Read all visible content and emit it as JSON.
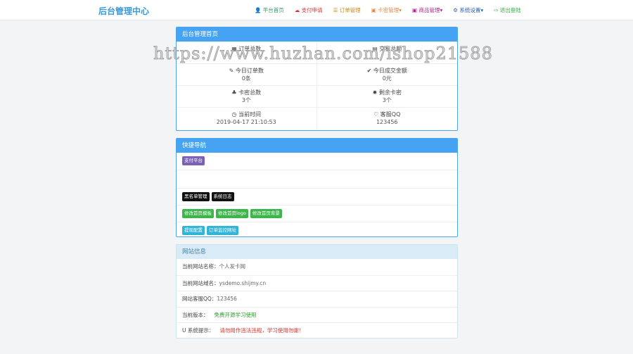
{
  "header": {
    "brand": "后台管理中心",
    "nav": [
      {
        "label": "平台首页",
        "icon": "user-icon",
        "color": "#3a9a6a"
      },
      {
        "label": "支付申请",
        "icon": "cloud-icon",
        "color": "#d9302c"
      },
      {
        "label": "订单管理",
        "icon": "list-icon",
        "color": "#c98a1f"
      },
      {
        "label": "卡密管理▾",
        "icon": "card-icon",
        "color": "#e08a4a"
      },
      {
        "label": "商品管理▾",
        "icon": "goods-icon",
        "color": "#b0268a"
      },
      {
        "label": "系统设置▾",
        "icon": "gear-icon",
        "color": "#2a5fb0"
      },
      {
        "label": "退出登陆",
        "icon": "logout-icon",
        "color": "#3aab4a"
      }
    ]
  },
  "home": {
    "title": "后台管理首页",
    "stats": [
      {
        "icon": "▦",
        "label": "订单总数",
        "value": ""
      },
      {
        "icon": "▤",
        "label": "交易总额",
        "value": ""
      },
      {
        "icon": "✎",
        "label": "今日订单数",
        "value": "0条"
      },
      {
        "icon": "✔",
        "label": "今日成交金额",
        "value": "0元"
      },
      {
        "icon": "♣",
        "label": "卡密总数",
        "value": "3个"
      },
      {
        "icon": "✹",
        "label": "剩余卡密",
        "value": "3个"
      },
      {
        "icon": "◷",
        "label": "当前时间",
        "value": "2019-04-17 21:10:53"
      },
      {
        "icon": "♡",
        "label": "客服QQ",
        "value": "123456"
      }
    ]
  },
  "quick": {
    "title": "快捷导航",
    "rows": [
      [
        {
          "label": "支付平台",
          "color": "#7b62b5"
        }
      ],
      [],
      [
        {
          "label": "黑名单管理",
          "color": "#111111"
        },
        {
          "label": "系统日志",
          "color": "#111111"
        }
      ],
      [
        {
          "label": "修改首页模板",
          "color": "#3cb54a"
        },
        {
          "label": "修改首页logo",
          "color": "#3cb54a"
        },
        {
          "label": "修改首页背景",
          "color": "#3cb54a"
        }
      ],
      [
        {
          "label": "提现配置",
          "color": "#30b4d8"
        },
        {
          "label": "订单监控网址",
          "color": "#30b4d8"
        }
      ]
    ]
  },
  "site": {
    "title": "网站信息",
    "rows": [
      {
        "label": "当前网站名称：",
        "value": "个人发卡网",
        "color": "#666666"
      },
      {
        "label": "当前网站域名：",
        "value": "ysdemo.shijmy.cn",
        "color": "#666666"
      },
      {
        "label": "网站客服QQ：",
        "value": "123456",
        "color": "#666666"
      },
      {
        "label": "当前版本：",
        "value": "免费开源学习使用",
        "color": "#2a9a2a"
      },
      {
        "label": "U 系统提示：",
        "value": "请勿用作违法违规，学习使用勿谢！",
        "color": "#d9302c"
      }
    ]
  },
  "watermark": "https://www.huzhan.com/ishop21588"
}
